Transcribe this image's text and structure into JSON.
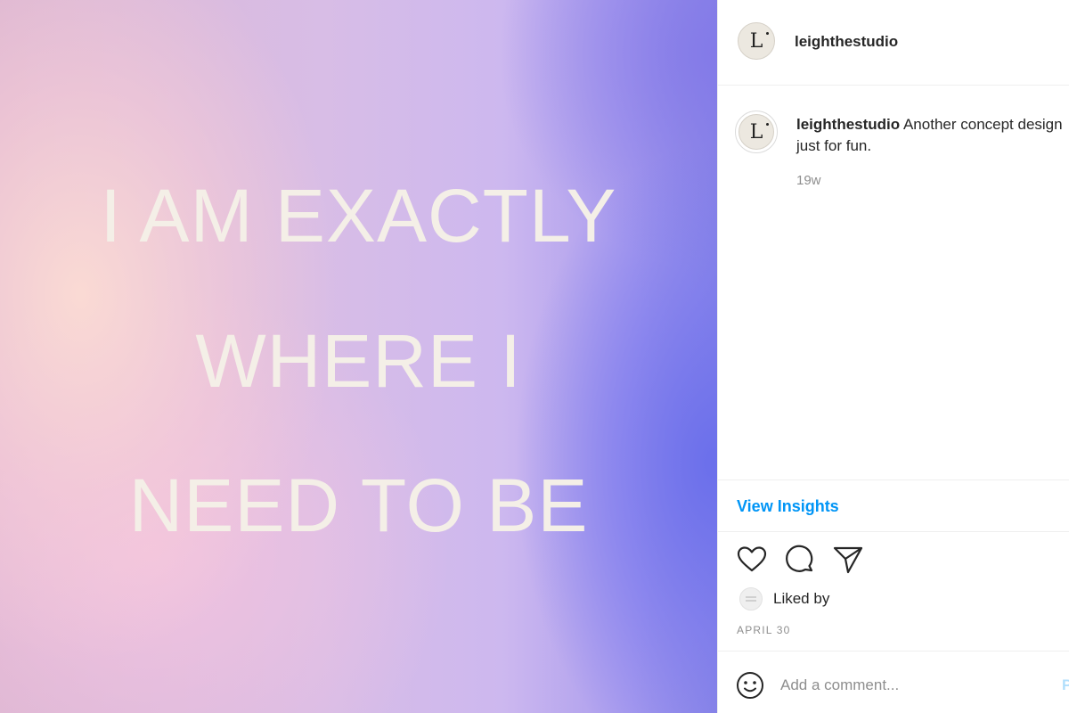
{
  "post": {
    "poster_lines": [
      "I AM EXACTLY",
      "WHERE I",
      "NEED TO BE"
    ]
  },
  "header": {
    "avatar_letter": "L",
    "username": "leighthestudio"
  },
  "caption": {
    "username": "leighthestudio",
    "text": "Another concept design just for fun.",
    "time": "19w"
  },
  "insights": {
    "label": "View Insights"
  },
  "actions": {
    "like_icon": "heart-icon",
    "comment_icon": "comment-bubble-icon",
    "share_icon": "paper-plane-icon"
  },
  "likes": {
    "text": "Liked by"
  },
  "date": "APRIL 30",
  "comment": {
    "placeholder": "Add a comment...",
    "post_label": "Post"
  },
  "colors": {
    "accent": "#0095f6",
    "post_disabled": "#b2dffc",
    "poster_text": "#f4efe7"
  }
}
